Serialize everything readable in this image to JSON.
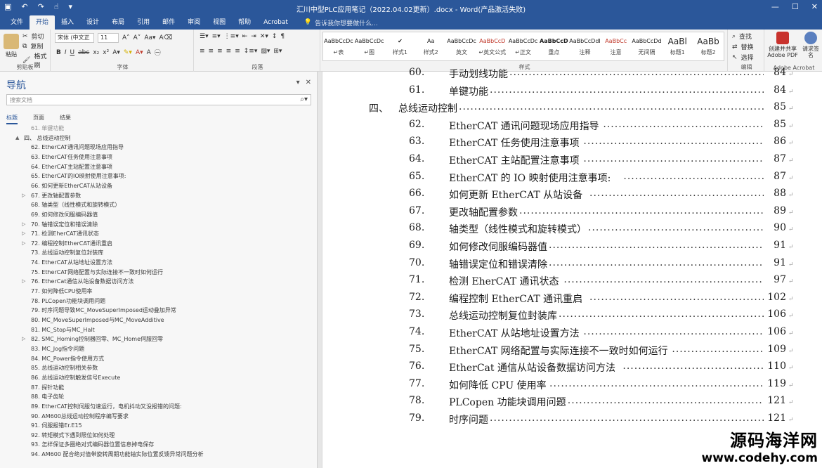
{
  "titlebar": {
    "title": "汇川中型PLC应用笔记（2022.04.02更新）.docx - Word(产品激活失败)",
    "qat": [
      "save-icon",
      "undo-icon",
      "redo-icon",
      "touch-mode-icon",
      "customize-icon"
    ]
  },
  "tabs": {
    "items": [
      "文件",
      "开始",
      "插入",
      "设计",
      "布局",
      "引用",
      "邮件",
      "审阅",
      "视图",
      "帮助",
      "Acrobat"
    ],
    "active": "开始",
    "tellme": "告诉我你想要做什么..."
  },
  "ribbon": {
    "clipboard": {
      "label": "剪贴板",
      "paste": "粘贴",
      "cut": "剪切",
      "copy": "复制",
      "format_painter": "格式刷"
    },
    "font": {
      "label": "字体",
      "font_name": "宋体 (中文正",
      "font_size": "11",
      "buttons": [
        "B",
        "I",
        "U",
        "abc",
        "x₂",
        "x²"
      ]
    },
    "paragraph": {
      "label": "段落"
    },
    "styles": {
      "label": "样式",
      "items": [
        {
          "sample": "AaBbCcDc",
          "name": "↵表"
        },
        {
          "sample": "AaBbCcDc",
          "name": "↵图"
        },
        {
          "sample": "✔",
          "name": "样式1"
        },
        {
          "sample": "Aa",
          "name": "样式2"
        },
        {
          "sample": "AaBbCcDc",
          "name": "英文"
        },
        {
          "sample": "AaBbCcD",
          "name": "↵英文公式"
        },
        {
          "sample": "AaBbCcDc",
          "name": "↵正文"
        },
        {
          "sample": "AaBbCcD",
          "name": "重点"
        },
        {
          "sample": "AaBbCcDdI",
          "name": "注释"
        },
        {
          "sample": "AaBbCc",
          "name": "注意"
        },
        {
          "sample": "AaBbCcDd",
          "name": "无间隔"
        },
        {
          "sample": "AaBl",
          "name": "标题1"
        },
        {
          "sample": "AaBb",
          "name": "标题2"
        }
      ]
    },
    "editing": {
      "label": "编辑",
      "find": "查找",
      "replace": "替换",
      "select": "选择"
    },
    "acrobat": {
      "label": "Adobe Acrobat",
      "create_pdf": "创建并共享Adobe PDF",
      "request_sig": "请求签名"
    }
  },
  "nav": {
    "title": "导航",
    "search_placeholder": "搜索文档",
    "tabs": [
      "标题",
      "页面",
      "结果"
    ],
    "active_tab": "标题",
    "items": [
      {
        "text": "61. 单键功能",
        "level": 2,
        "arrow": ""
      },
      {
        "text": "四、 总线运动控制",
        "level": 1,
        "arrow": "▲"
      },
      {
        "text": "62. EtherCAT通讯问题现场应用指导",
        "level": 2,
        "arrow": ""
      },
      {
        "text": "63. EtherCAT任务使用注意事项",
        "level": 2,
        "arrow": ""
      },
      {
        "text": "64. EtherCAT主站配置注意事项",
        "level": 2,
        "arrow": ""
      },
      {
        "text": "65. EtherCAT的IO映射使用注意事项:",
        "level": 2,
        "arrow": ""
      },
      {
        "text": "66. 如何更新EtherCAT从站设备",
        "level": 2,
        "arrow": ""
      },
      {
        "text": "67. 更改轴配置参数",
        "level": 2,
        "arrow": "▷"
      },
      {
        "text": "68. 轴类型（线性模式和旋转模式）",
        "level": 2,
        "arrow": ""
      },
      {
        "text": "69. 如何修改伺服编码器值",
        "level": 2,
        "arrow": ""
      },
      {
        "text": "70. 轴错误定位和错误清除",
        "level": 2,
        "arrow": "▷"
      },
      {
        "text": "71. 检测EherCAT通讯状态",
        "level": 2,
        "arrow": "▷"
      },
      {
        "text": "72. 编程控制EtherCAT通讯重启",
        "level": 2,
        "arrow": "▷"
      },
      {
        "text": "73. 总线运动控制复位封装库",
        "level": 2,
        "arrow": ""
      },
      {
        "text": "74. EtherCAT从站地址设置方法",
        "level": 2,
        "arrow": ""
      },
      {
        "text": "75. EtherCAT网络配置与实际连接不一致时如何运行",
        "level": 2,
        "arrow": ""
      },
      {
        "text": "76. EtherCat通信从站设备数据访问方法",
        "level": 2,
        "arrow": "▷"
      },
      {
        "text": "77. 如何降低CPU使用率",
        "level": 2,
        "arrow": ""
      },
      {
        "text": "78. PLCopen功能块调用问题",
        "level": 2,
        "arrow": ""
      },
      {
        "text": "79. 时序问题导致MC_MoveSuperImposed运动叠加异常",
        "level": 2,
        "arrow": ""
      },
      {
        "text": "80. MC_MoveSuperImposed与MC_MoveAdditive",
        "level": 2,
        "arrow": ""
      },
      {
        "text": "81. MC_Stop与MC_Halt",
        "level": 2,
        "arrow": ""
      },
      {
        "text": "82. SMC_Homing控制器回零、MC_Home伺服回零",
        "level": 2,
        "arrow": "▷"
      },
      {
        "text": "83. MC_Jog指令问题",
        "level": 2,
        "arrow": ""
      },
      {
        "text": "84. MC_Power指令使用方式",
        "level": 2,
        "arrow": ""
      },
      {
        "text": "85. 总线运动控制相关参数",
        "level": 2,
        "arrow": ""
      },
      {
        "text": "86. 总线运动控制触发信号Execute",
        "level": 2,
        "arrow": ""
      },
      {
        "text": "87. 探针功能",
        "level": 2,
        "arrow": ""
      },
      {
        "text": "88. 电子齿轮",
        "level": 2,
        "arrow": ""
      },
      {
        "text": "89. EtherCAT控制伺服匀速运行，电机抖动又没报错的问题:",
        "level": 2,
        "arrow": ""
      },
      {
        "text": "90. AM600总线运动控制程序编写要求",
        "level": 2,
        "arrow": ""
      },
      {
        "text": "91. 伺服报错Er.E15",
        "level": 2,
        "arrow": ""
      },
      {
        "text": "92. 转矩模式下遇到限位如何处理",
        "level": 2,
        "arrow": ""
      },
      {
        "text": "93. 怎样保证多圈绝对式编码器位置信息掉电保存",
        "level": 2,
        "arrow": ""
      },
      {
        "text": "94. AM600 配合绝对值带旋转周期功能轴实际位置反馈异常问题分析",
        "level": 2,
        "arrow": ""
      }
    ]
  },
  "doc": {
    "toc": [
      {
        "num": "60.",
        "title": "手动划线功能",
        "page": "84",
        "level": 2
      },
      {
        "num": "61.",
        "title": "单键功能",
        "page": "84",
        "level": 2
      },
      {
        "num": "四、",
        "title": "总线运动控制",
        "page": "85",
        "level": 1
      },
      {
        "num": "62.",
        "title": "EtherCAT 通讯问题现场应用指导",
        "page": "85",
        "level": 2
      },
      {
        "num": "63.",
        "title": "EtherCAT 任务使用注意事项",
        "page": "86",
        "level": 2
      },
      {
        "num": "64.",
        "title": "EtherCAT 主站配置注意事项",
        "page": "87",
        "level": 2
      },
      {
        "num": "65.",
        "title": "EtherCAT 的 IO 映射使用注意事项:",
        "page": "87",
        "level": 2
      },
      {
        "num": "66.",
        "title": "如何更新 EtherCAT 从站设备",
        "page": "88",
        "level": 2
      },
      {
        "num": "67.",
        "title": "更改轴配置参数",
        "page": "89",
        "level": 2
      },
      {
        "num": "68.",
        "title": "轴类型（线性模式和旋转模式）",
        "page": "90",
        "level": 2
      },
      {
        "num": "69.",
        "title": "如何修改伺服编码器值",
        "page": "91",
        "level": 2
      },
      {
        "num": "70.",
        "title": "轴错误定位和错误清除",
        "page": "91",
        "level": 2
      },
      {
        "num": "71.",
        "title": "检测 EherCAT 通讯状态",
        "page": "97",
        "level": 2
      },
      {
        "num": "72.",
        "title": "编程控制 EtherCAT 通讯重启",
        "page": "102",
        "level": 2
      },
      {
        "num": "73.",
        "title": "总线运动控制复位封装库",
        "page": "106",
        "level": 2
      },
      {
        "num": "74.",
        "title": "EtherCAT 从站地址设置方法",
        "page": "106",
        "level": 2
      },
      {
        "num": "75.",
        "title": "EtherCAT 网络配置与实际连接不一致时如何运行",
        "page": "109",
        "level": 2
      },
      {
        "num": "76.",
        "title": "EtherCat 通信从站设备数据访问方法",
        "page": "110",
        "level": 2
      },
      {
        "num": "77.",
        "title": "如何降低 CPU 使用率",
        "page": "119",
        "level": 2
      },
      {
        "num": "78.",
        "title": "PLCopen 功能块调用问题",
        "page": "121",
        "level": 2
      },
      {
        "num": "79.",
        "title": "时序问题",
        "page": "121",
        "level": 2
      }
    ]
  },
  "watermark": {
    "line1": "源码海洋网",
    "line2": "www.codehy.com"
  }
}
